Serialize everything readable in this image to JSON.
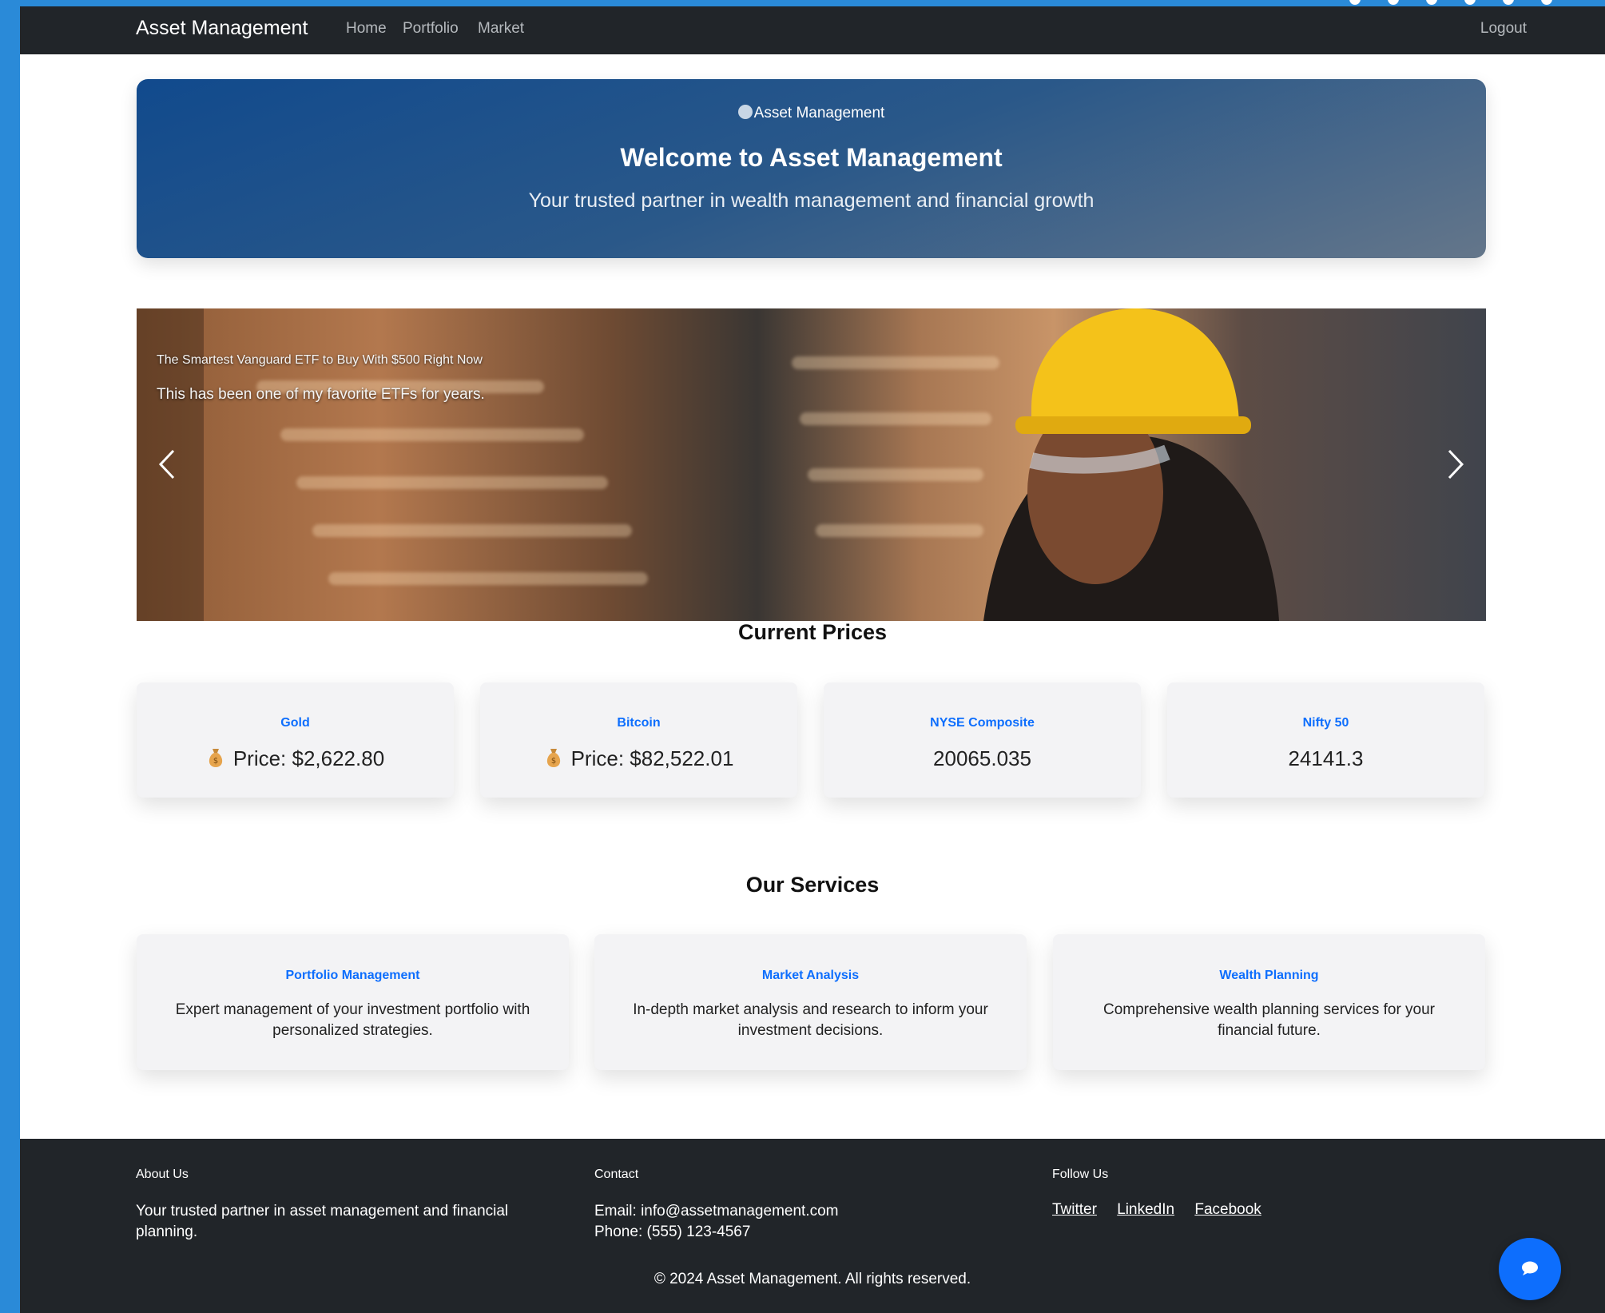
{
  "navbar": {
    "brand": "Asset Management",
    "links": [
      "Home",
      "Portfolio",
      "Market"
    ],
    "logout": "Logout"
  },
  "hero": {
    "logo_alt": "Asset Management",
    "title": "Welcome to Asset Management",
    "subtitle": "Your trusted partner in wealth management and financial growth"
  },
  "carousel": {
    "caption_title": "The Smartest Vanguard ETF to Buy With $500 Right Now",
    "caption_text": "This has been one of my favorite ETFs for years.",
    "prev_icon": "chevron-left-icon",
    "next_icon": "chevron-right-icon"
  },
  "prices": {
    "title": "Current Prices",
    "items": [
      {
        "name": "Gold",
        "value": "Price: $2,622.80",
        "icon": "money-bag-icon"
      },
      {
        "name": "Bitcoin",
        "value": "Price: $82,522.01",
        "icon": "money-bag-icon"
      },
      {
        "name": "NYSE Composite",
        "value": "20065.035"
      },
      {
        "name": "Nifty 50",
        "value": "24141.3"
      }
    ]
  },
  "services": {
    "title": "Our Services",
    "items": [
      {
        "name": "Portfolio Management",
        "text": "Expert management of your investment portfolio with personalized strategies."
      },
      {
        "name": "Market Analysis",
        "text": "In-depth market analysis and research to inform your investment decisions."
      },
      {
        "name": "Wealth Planning",
        "text": "Comprehensive wealth planning services for your financial future."
      }
    ]
  },
  "footer": {
    "about_title": "About Us",
    "about_text": "Your trusted partner in asset management and financial planning.",
    "contact_title": "Contact",
    "email": "Email: info@assetmanagement.com",
    "phone": "Phone: (555) 123-4567",
    "follow_title": "Follow Us",
    "social": [
      "Twitter",
      "LinkedIn",
      "Facebook"
    ],
    "copyright": "© 2024 Asset Management. All rights reserved."
  },
  "colors": {
    "accent": "#0d6efd",
    "navbar": "#212529",
    "frame_bg": "#2a8ad8"
  }
}
